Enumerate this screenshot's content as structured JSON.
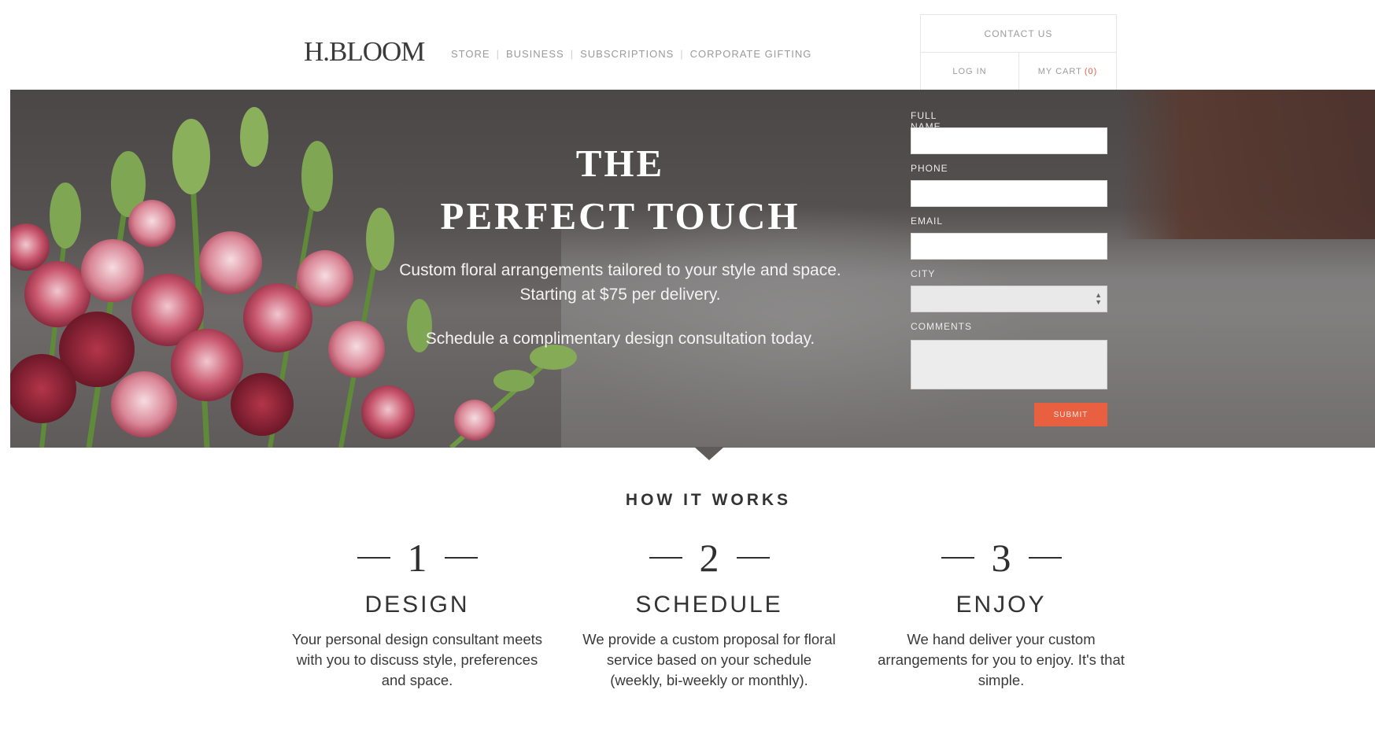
{
  "header": {
    "logo": "H.BLOOM",
    "nav": [
      "STORE",
      "BUSINESS",
      "SUBSCRIPTIONS",
      "CORPORATE GIFTING"
    ],
    "contact": "CONTACT US",
    "login": "LOG IN",
    "cart_label": "MY CART",
    "cart_count": "(0)"
  },
  "hero": {
    "title_line1": "THE",
    "title_line2": "PERFECT TOUCH",
    "description": "Custom floral arrangements tailored to your style and space. Starting at $75 per delivery.",
    "cta": "Schedule a complimentary design consultation today."
  },
  "form": {
    "full_name_label": "FULL NAME",
    "phone_label": "PHONE",
    "email_label": "EMAIL",
    "city_label": "CITY",
    "comments_label": "COMMENTS",
    "submit_label": "SUBMIT"
  },
  "how_it_works": {
    "title": "HOW IT WORKS",
    "steps": [
      {
        "number": "1",
        "title": "DESIGN",
        "description": "Your personal design consultant meets with you to discuss style, preferences and space."
      },
      {
        "number": "2",
        "title": "SCHEDULE",
        "description": "We provide a custom proposal for floral service based on your schedule (weekly, bi-weekly or monthly)."
      },
      {
        "number": "3",
        "title": "ENJOY",
        "description": "We hand deliver your custom arrangements for you to enjoy. It's that simple."
      }
    ]
  },
  "colors": {
    "accent": "#e8603f",
    "text": "#2f2f2f",
    "hero_bg": "#575252"
  }
}
